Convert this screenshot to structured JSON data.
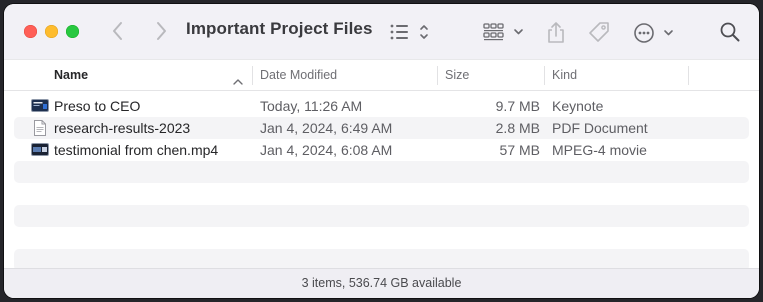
{
  "window": {
    "title": "Important Project Files"
  },
  "toolbar": {
    "back_icon": "chevron-left-icon",
    "forward_icon": "chevron-right-icon",
    "view_icon": "list-view-icon",
    "group_icon": "group-grid-icon",
    "share_icon": "share-icon",
    "tag_icon": "tag-icon",
    "more_icon": "ellipsis-circle-icon",
    "search_icon": "search-icon"
  },
  "columns": {
    "name": "Name",
    "date": "Date Modified",
    "size": "Size",
    "kind": "Kind"
  },
  "files": [
    {
      "name": "Preso to CEO",
      "date": "Today, 11:26 AM",
      "size": "9.7 MB",
      "kind": "Keynote",
      "icon": "keynote-file-icon"
    },
    {
      "name": "research-results-2023",
      "date": "Jan 4, 2024, 6:49 AM",
      "size": "2.8 MB",
      "kind": "PDF Document",
      "icon": "pdf-file-icon"
    },
    {
      "name": "testimonial from chen.mp4",
      "date": "Jan 4, 2024, 6:08 AM",
      "size": "57 MB",
      "kind": "MPEG-4 movie",
      "icon": "movie-file-icon"
    }
  ],
  "status": {
    "text": "3 items, 536.74 GB available"
  },
  "colors": {
    "accent_close": "#ff5f57",
    "accent_minimize": "#febc2e",
    "accent_zoom": "#28c840",
    "stripe": "#f4f4f6"
  }
}
